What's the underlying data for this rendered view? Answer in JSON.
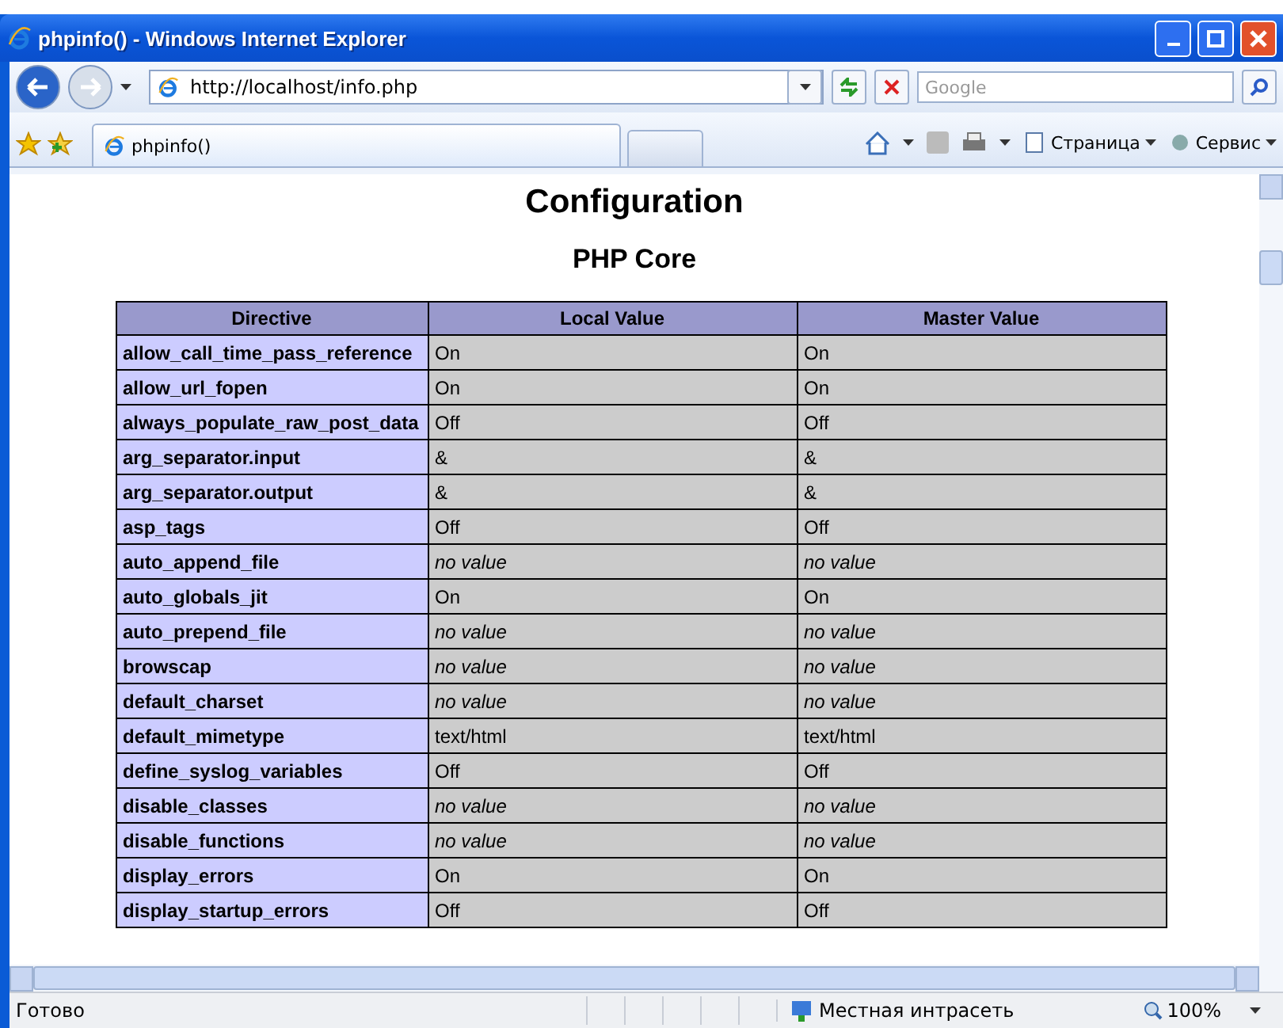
{
  "window": {
    "title": "phpinfo() - Windows Internet Explorer"
  },
  "address": {
    "value": "http://localhost/info.php"
  },
  "search": {
    "placeholder": "Google"
  },
  "tabs": [
    {
      "label": "phpinfo()",
      "selected": true
    }
  ],
  "command_bar": [
    {
      "label": "Страница"
    },
    {
      "label": "Сервис"
    }
  ],
  "page": {
    "heading": "Configuration",
    "subheading": "PHP Core",
    "columns": [
      "Directive",
      "Local Value",
      "Master Value"
    ],
    "rows": [
      {
        "directive": "allow_call_time_pass_reference",
        "local": "On",
        "master": "On",
        "italic": false
      },
      {
        "directive": "allow_url_fopen",
        "local": "On",
        "master": "On",
        "italic": false
      },
      {
        "directive": "always_populate_raw_post_data",
        "local": "Off",
        "master": "Off",
        "italic": false
      },
      {
        "directive": "arg_separator.input",
        "local": "&",
        "master": "&",
        "italic": false
      },
      {
        "directive": "arg_separator.output",
        "local": "&",
        "master": "&",
        "italic": false
      },
      {
        "directive": "asp_tags",
        "local": "Off",
        "master": "Off",
        "italic": false
      },
      {
        "directive": "auto_append_file",
        "local": "no value",
        "master": "no value",
        "italic": true
      },
      {
        "directive": "auto_globals_jit",
        "local": "On",
        "master": "On",
        "italic": false
      },
      {
        "directive": "auto_prepend_file",
        "local": "no value",
        "master": "no value",
        "italic": true
      },
      {
        "directive": "browscap",
        "local": "no value",
        "master": "no value",
        "italic": true
      },
      {
        "directive": "default_charset",
        "local": "no value",
        "master": "no value",
        "italic": true
      },
      {
        "directive": "default_mimetype",
        "local": "text/html",
        "master": "text/html",
        "italic": false
      },
      {
        "directive": "define_syslog_variables",
        "local": "Off",
        "master": "Off",
        "italic": false
      },
      {
        "directive": "disable_classes",
        "local": "no value",
        "master": "no value",
        "italic": true
      },
      {
        "directive": "disable_functions",
        "local": "no value",
        "master": "no value",
        "italic": true
      },
      {
        "directive": "display_errors",
        "local": "On",
        "master": "On",
        "italic": false
      },
      {
        "directive": "display_startup_errors",
        "local": "Off",
        "master": "Off",
        "italic": false
      }
    ]
  },
  "status_bar": {
    "text": "Готово",
    "zone": "Местная интрасеть",
    "zoom": "100%"
  }
}
